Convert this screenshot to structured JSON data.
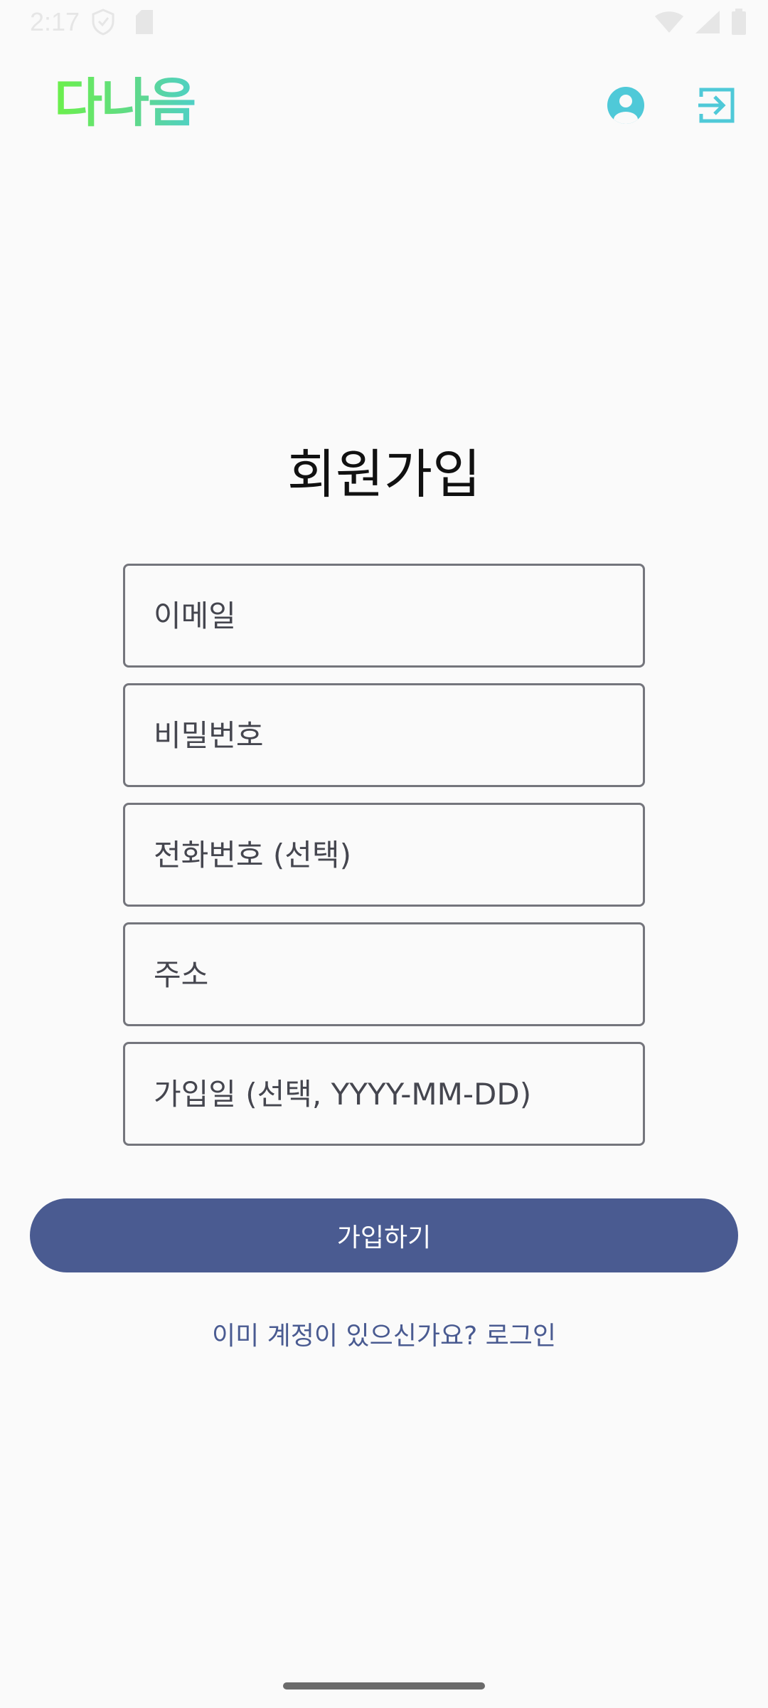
{
  "status_bar": {
    "time": "2:17",
    "icons": [
      "shield-icon",
      "sim-card-icon",
      "wifi-icon",
      "signal-icon",
      "battery-icon"
    ]
  },
  "app_bar": {
    "logo_text": "다나음",
    "profile_icon": "account-circle-icon",
    "logout_icon": "logout-icon",
    "accent_color": "#4fc9d8"
  },
  "form": {
    "title": "회원가입",
    "fields": [
      {
        "placeholder": "이메일",
        "value": ""
      },
      {
        "placeholder": "비밀번호",
        "value": ""
      },
      {
        "placeholder": "전화번호 (선택)",
        "value": ""
      },
      {
        "placeholder": "주소",
        "value": ""
      },
      {
        "placeholder": "가입일 (선택, YYYY-MM-DD)",
        "value": ""
      }
    ],
    "submit_label": "가입하기",
    "login_link": "이미 계정이 있으신가요? 로그인"
  },
  "colors": {
    "primary": "#4a5b91",
    "background": "#fafafa",
    "outline": "#74757c"
  }
}
